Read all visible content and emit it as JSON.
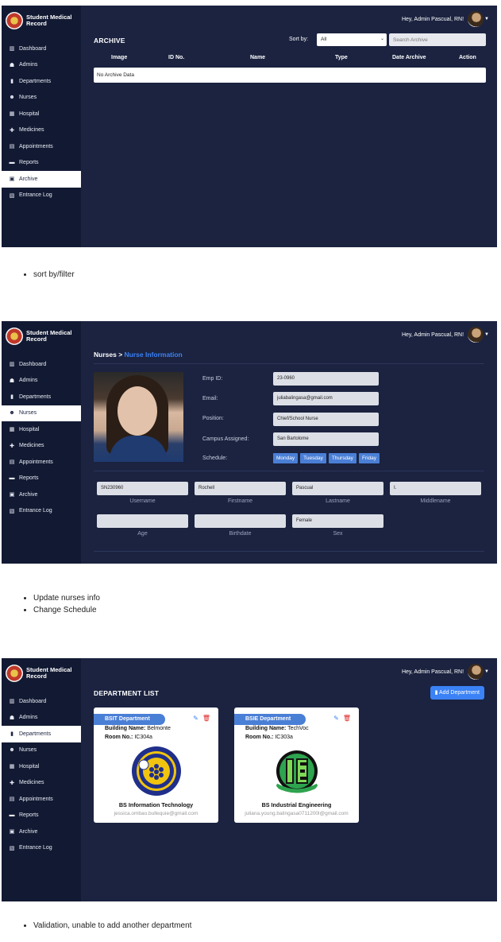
{
  "brand": {
    "title": "Student Medical Record"
  },
  "user": {
    "greeting": "Hey, Admin Pascual, RN!"
  },
  "sidebar": {
    "items": [
      {
        "label": "Dashboard",
        "icon": "chart-icon"
      },
      {
        "label": "Admins",
        "icon": "users-cog-icon"
      },
      {
        "label": "Departments",
        "icon": "building-icon"
      },
      {
        "label": "Nurses",
        "icon": "user-nurse-icon"
      },
      {
        "label": "Hospital",
        "icon": "hospital-icon"
      },
      {
        "label": "Medicines",
        "icon": "medkit-icon"
      },
      {
        "label": "Appointments",
        "icon": "calendar-icon"
      },
      {
        "label": "Reports",
        "icon": "folder-icon"
      },
      {
        "label": "Archive",
        "icon": "archive-icon"
      },
      {
        "label": "Entrance Log",
        "icon": "log-icon"
      }
    ]
  },
  "panel1": {
    "title": "ARCHIVE",
    "sort_label": "Sort by:",
    "sort_value": "All",
    "search_placeholder": "Search Archive",
    "columns": [
      "Image",
      "ID No.",
      "Name",
      "Type",
      "Date Archive",
      "Action"
    ],
    "empty_text": "No Archive Data",
    "active_item": "Archive"
  },
  "caption1": [
    "sort by/filter"
  ],
  "panel2": {
    "breadcrumb_root": "Nurses",
    "breadcrumb_sep": ">",
    "breadcrumb_current": "Nurse Information",
    "active_item": "Nurses",
    "labels": {
      "emp": "Emp ID:",
      "email": "Email:",
      "position": "Position:",
      "campus": "Campus Assigned:",
      "schedule": "Schedule:"
    },
    "values": {
      "emp": "23-0960",
      "email": "juliabalingasa@gmail.com",
      "position": "Chief/School Nurse",
      "campus": "San Bartolome"
    },
    "schedule": [
      "Monday",
      "Tuesday",
      "Thursday",
      "Friday"
    ],
    "fields": [
      {
        "value": "SN230960",
        "label": "Username"
      },
      {
        "value": "Rochell",
        "label": "Firstname"
      },
      {
        "value": "Pascual",
        "label": "Lastname"
      },
      {
        "value": "I.",
        "label": "Middlename"
      },
      {
        "value": "",
        "label": "Age"
      },
      {
        "value": "",
        "label": "Birthdate"
      },
      {
        "value": "Female",
        "label": "Sex"
      }
    ]
  },
  "caption2": [
    "Update nurses info",
    "Change Schedule"
  ],
  "panel3": {
    "title": "DEPARTMENT LIST",
    "add_button": "Add Department",
    "active_item": "Departments",
    "cards": [
      {
        "dept": "BSIT Department",
        "building_label": "Building Name:",
        "building": "Belmonte",
        "room_label": "Room No.:",
        "room": "IC304a",
        "program": "BS Information Technology",
        "email": "jessica.ombao.bullequie@gmail.com"
      },
      {
        "dept": "BSIE Department",
        "building_label": "Building Name:",
        "building": "TechVoc",
        "room_label": "Room No.:",
        "room": "IC303a",
        "program": "BS Industrial Engineering",
        "email": "juliana.young.balingasa0711200l@gmail.com"
      }
    ]
  },
  "caption3": [
    "Validation, unable to add another department"
  ],
  "colors": {
    "panel_bg": "#1b2340",
    "sidebar_bg": "#121a33",
    "accent": "#3b82f6",
    "delete": "#e02424"
  }
}
